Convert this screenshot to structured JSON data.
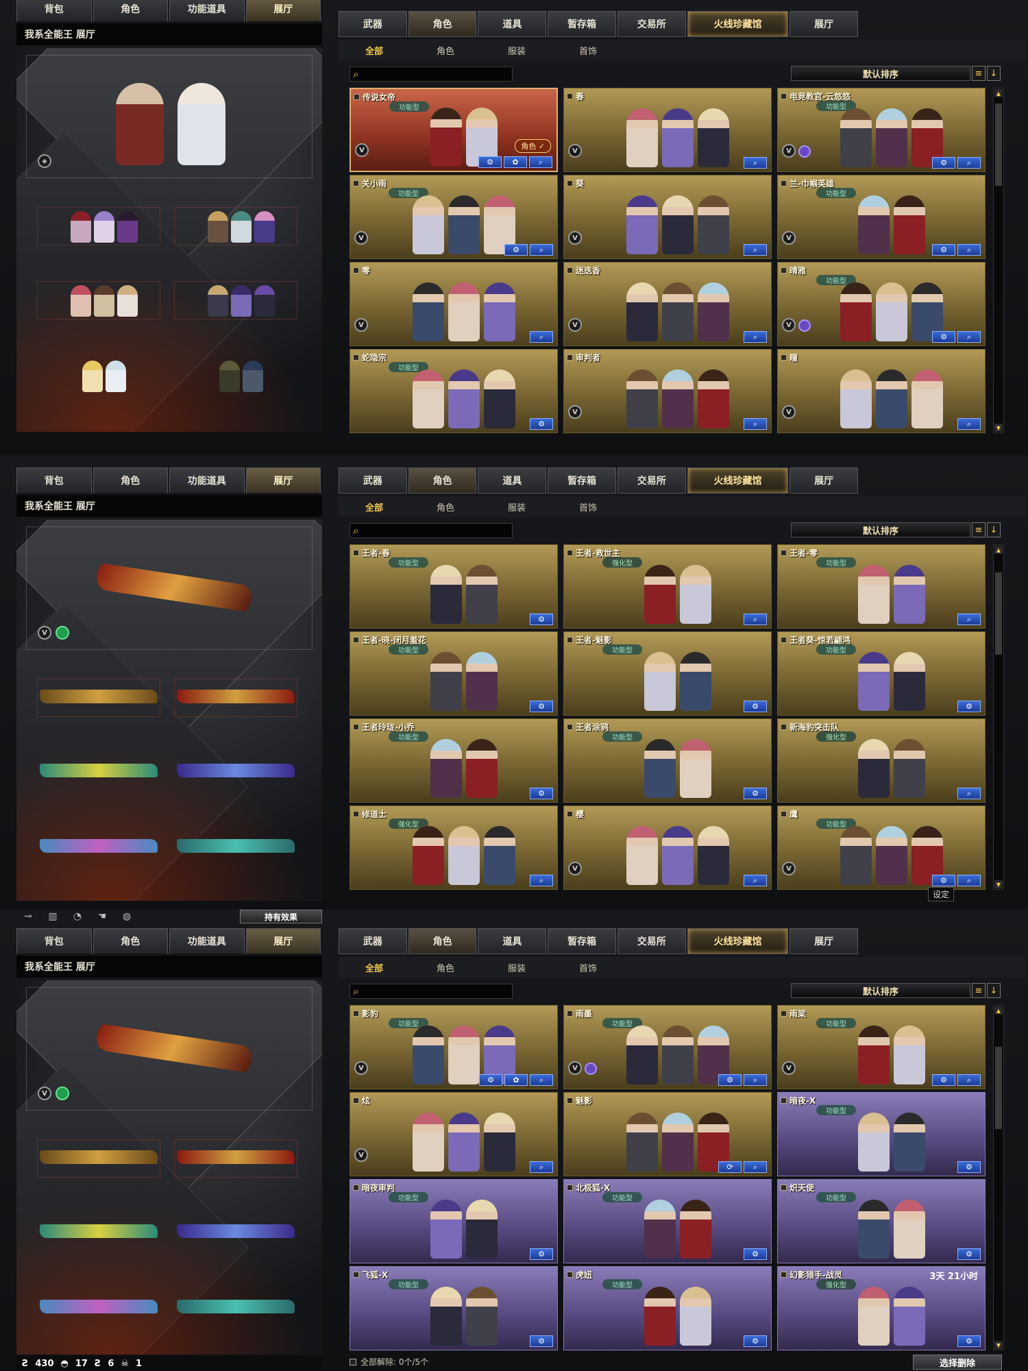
{
  "left_tabs": [
    "背包",
    "角色",
    "功能道具",
    "展厅"
  ],
  "left_title": "我系全能王 展厅",
  "right_tabs": [
    "武器",
    "角色",
    "道具",
    "暂存箱",
    "交易所",
    "火线珍藏馆",
    "展厅"
  ],
  "sub_tabs": [
    "全部",
    "角色",
    "服装",
    "首饰"
  ],
  "sort_label": "默认排序",
  "top_bar": {
    "effects_label": "持有效果"
  },
  "footer": {
    "text": "全部解除: 0个/5个",
    "delete_label": "选择删除"
  },
  "stats": [
    "430",
    "17",
    "6",
    "1"
  ],
  "tooltip": "设定",
  "action_glyphs": {
    "set": "⚙",
    "gear": "✿",
    "search": "⌕",
    "swap": "⟳"
  },
  "role_badge": "角色 ✓",
  "icons": {
    "v_badge": "V",
    "search": "⌕",
    "menu": "≡",
    "down": "↓",
    "up": "▲",
    "down_small": "▼"
  },
  "colors": {
    "gold": "#f2c94c",
    "action_blue": "#2f5cd0",
    "card_gold": "#a08a48",
    "card_purple": "#6b5c98"
  },
  "panels": [
    {
      "cards": [
        {
          "name": "传说女帝",
          "type": "功能型",
          "style": "red",
          "v": true,
          "portraits": 2,
          "role_badge": true,
          "actions": [
            "set",
            "gear",
            "search"
          ]
        },
        {
          "name": "春",
          "v": true,
          "portraits": 3,
          "actions": [
            "search"
          ]
        },
        {
          "name": "电竞教官-云悠悠",
          "type": "功能型",
          "v": true,
          "p": true,
          "portraits": 3,
          "actions": [
            "set",
            "search"
          ]
        },
        {
          "name": "关小雨",
          "type": "功能型",
          "v": true,
          "portraits": 3,
          "actions": [
            "set",
            "search"
          ]
        },
        {
          "name": "葵",
          "v": true,
          "portraits": 3,
          "actions": [
            "search"
          ]
        },
        {
          "name": "兰-巾帼英雄",
          "type": "功能型",
          "v": true,
          "portraits": 2,
          "actions": [
            "set",
            "search"
          ]
        },
        {
          "name": "零",
          "v": true,
          "portraits": 3,
          "actions": [
            "search"
          ]
        },
        {
          "name": "迷迭香",
          "v": true,
          "portraits": 3,
          "actions": [
            "search"
          ]
        },
        {
          "name": "晴雅",
          "type": "功能型",
          "v": true,
          "p": true,
          "portraits": 3,
          "actions": [
            "set",
            "search"
          ]
        },
        {
          "name": "蛇隐宗",
          "type": "功能型",
          "portraits": 3,
          "actions": [
            "set"
          ]
        },
        {
          "name": "审判者",
          "v": true,
          "portraits": 3,
          "actions": [
            "search"
          ]
        },
        {
          "name": "瞳",
          "v": true,
          "portraits": 3,
          "actions": [
            "search"
          ]
        }
      ]
    },
    {
      "cards": [
        {
          "name": "王者-春",
          "type": "功能型",
          "portraits": 2,
          "actions": [
            "set"
          ]
        },
        {
          "name": "王者-救世主",
          "type": "强化型",
          "portraits": 2,
          "actions": [
            "search"
          ]
        },
        {
          "name": "王者-零",
          "type": "功能型",
          "portraits": 2,
          "actions": [
            "search"
          ]
        },
        {
          "name": "王者-晓-闭月羞花",
          "type": "功能型",
          "portraits": 2,
          "actions": [
            "set"
          ]
        },
        {
          "name": "王者-魅影",
          "type": "功能型",
          "portraits": 2,
          "actions": [
            "set"
          ]
        },
        {
          "name": "王者葵-惊若翩鸿",
          "type": "功能型",
          "portraits": 2,
          "actions": [
            "set"
          ]
        },
        {
          "name": "王者玲珑-小乔",
          "type": "功能型",
          "portraits": 2,
          "actions": [
            "set"
          ]
        },
        {
          "name": "王者涂鸦",
          "type": "功能型",
          "portraits": 2,
          "actions": [
            "set"
          ]
        },
        {
          "name": "新海豹突击队",
          "type": "强化型",
          "portraits": 2,
          "actions": [
            "search"
          ]
        },
        {
          "name": "修道士",
          "type": "强化型",
          "portraits": 3,
          "actions": [
            "search"
          ]
        },
        {
          "name": "樱",
          "v": true,
          "portraits": 3,
          "actions": [
            "search"
          ]
        },
        {
          "name": "鹰",
          "type": "功能型",
          "v": true,
          "portraits": 3,
          "actions": [
            "set",
            "search"
          ]
        }
      ]
    },
    {
      "cards": [
        {
          "name": "影豹",
          "type": "功能型",
          "v": true,
          "portraits": 3,
          "actions": [
            "set",
            "gear",
            "search"
          ]
        },
        {
          "name": "雨墨",
          "type": "功能型",
          "v": true,
          "p": true,
          "portraits": 3,
          "actions": [
            "set",
            "search"
          ]
        },
        {
          "name": "雨棠",
          "type": "功能型",
          "v": true,
          "portraits": 2,
          "actions": [
            "set",
            "search"
          ]
        },
        {
          "name": "炫",
          "v": true,
          "portraits": 3,
          "actions": [
            "search"
          ]
        },
        {
          "name": "魅影",
          "portraits": 3,
          "actions": [
            "swap",
            "search"
          ]
        },
        {
          "name": "暗夜-X",
          "type": "功能型",
          "style": "purple",
          "portraits": 2,
          "actions": [
            "set"
          ]
        },
        {
          "name": "暗夜审判",
          "type": "功能型",
          "style": "purple",
          "portraits": 2,
          "actions": [
            "set"
          ]
        },
        {
          "name": "北极狐-X",
          "type": "功能型",
          "style": "purple",
          "portraits": 2,
          "actions": [
            "set"
          ]
        },
        {
          "name": "炽天使",
          "type": "功能型",
          "style": "purple",
          "portraits": 2,
          "actions": [
            "set"
          ]
        },
        {
          "name": "飞狐-X",
          "type": "功能型",
          "style": "purple",
          "portraits": 2,
          "actions": [
            "set"
          ]
        },
        {
          "name": "虎妞",
          "type": "功能型",
          "style": "purple",
          "portraits": 2,
          "actions": [
            "set"
          ]
        },
        {
          "name": "幻影猎手-战灵",
          "type": "强化型",
          "style": "purple",
          "portraits": 2,
          "actions": [
            "set"
          ],
          "timer": "3天 21小时"
        }
      ]
    }
  ]
}
